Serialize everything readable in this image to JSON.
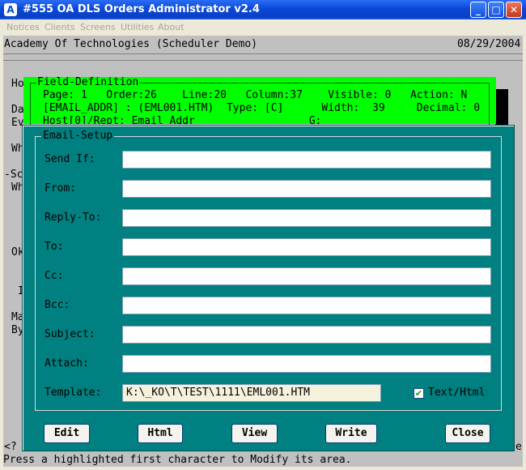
{
  "window": {
    "title": "#555  OA  DLS Orders Administrator v2.4",
    "icon": "app-icon",
    "controls": [
      "minimize",
      "maximize",
      "close"
    ]
  },
  "menu": [
    "Notices",
    "Clients",
    "Screens",
    "Utilities",
    "About"
  ],
  "terminal": {
    "header_left": "Academy Of Technologies (Scheduler Demo)",
    "header_right": "08/29/2004",
    "bg_left": [
      "Ho",
      "Da",
      "Ev",
      "Wh",
      "-Sc",
      "Wh",
      "Ok",
      "I",
      "Ma",
      "By"
    ],
    "bg_bottom_left": "<?",
    "bg_bottom_right": "e",
    "status": "Press a highlighted first character to Modify its area."
  },
  "field_definition": {
    "legend": "Field-Definition",
    "line1": "Page: 1   Order:26    Line:20   Column:37    Visible: 0   Action: N",
    "line2": "[EMAIL_ADDR] : (EML001.HTM)  Type: [C]      Width:  39     Decimal: 0",
    "line3": "Host[0]/Rept: Email Addr                  G:"
  },
  "email_setup": {
    "legend": "Email-Setup",
    "fields": [
      {
        "label": "Send If:",
        "value": ""
      },
      {
        "label": "From:",
        "value": ""
      },
      {
        "label": "Reply-To:",
        "value": ""
      },
      {
        "label": "To:",
        "value": ""
      },
      {
        "label": "Cc:",
        "value": ""
      },
      {
        "label": "Bcc:",
        "value": ""
      },
      {
        "label": "Subject:",
        "value": ""
      },
      {
        "label": "Attach:",
        "value": ""
      }
    ],
    "template_label": "Template:",
    "template_value": "K:\\_KO\\T\\TEST\\1111\\EML001.HTM",
    "text_html_label": "Text/Html",
    "text_html_checked": true,
    "buttons": {
      "edit": "Edit",
      "html": "Html",
      "view": "View",
      "write": "Write",
      "close": "Close"
    }
  },
  "colors": {
    "title_blue": "#0a48d6",
    "field_def_green": "#00ff00",
    "dialog_teal": "#008080",
    "terminal_gray": "#c0c0c0"
  }
}
